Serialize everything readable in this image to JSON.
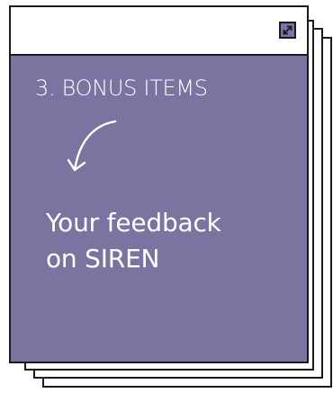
{
  "card": {
    "heading": "3. BONUS ITEMS",
    "body_lines": [
      "Your feedback",
      "on SIREN"
    ]
  },
  "icons": {
    "expand": "expand-arrows-icon",
    "arrow": "curved-arrow-down-left-icon"
  },
  "colors": {
    "panel": "#7b73a0",
    "text": "#ffffff",
    "border": "#1a1a1a",
    "background": "#ffffff"
  }
}
